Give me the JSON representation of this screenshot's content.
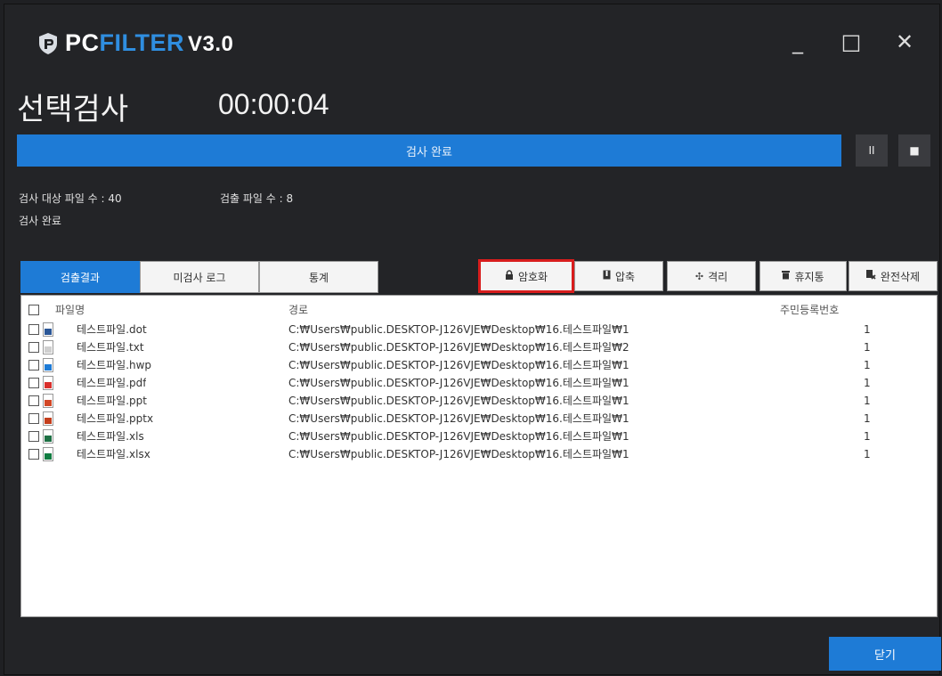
{
  "app": {
    "brand_pc": "PC",
    "brand_filter": "FILTER",
    "version": "V3.0",
    "accent": "#1e7bd6",
    "window_controls": [
      {
        "name": "minimize-icon",
        "glyph": "_"
      },
      {
        "name": "maximize-icon",
        "glyph": "□"
      },
      {
        "name": "close-icon",
        "glyph": "✕"
      }
    ]
  },
  "scan": {
    "title": "선택검사",
    "elapsed": "00:00:04",
    "progress_label": "검사 완료",
    "progress_fraction": 1.0,
    "pause_glyph": "II",
    "stop_glyph": "■",
    "target_count_label": "검사 대상 파일 수 : 40",
    "detected_count_label": "검출 파일 수 : 8",
    "status": "검사 완료"
  },
  "tabs": [
    {
      "label": "검출결과",
      "active": true
    },
    {
      "label": "미검사 로그",
      "active": false
    },
    {
      "label": "통계",
      "active": false
    }
  ],
  "actions": [
    {
      "label": "암호화",
      "icon": "lock-icon",
      "glyph": "🔒︎",
      "highlight": true
    },
    {
      "label": "압축",
      "icon": "archive-icon",
      "glyph": "▮",
      "highlight": false
    },
    {
      "label": "격리",
      "icon": "move-icon",
      "glyph": "✣",
      "highlight": false
    },
    {
      "label": "휴지통",
      "icon": "trash-icon",
      "glyph": "▬",
      "highlight": false
    },
    {
      "label": "완전삭제",
      "icon": "delete-icon",
      "glyph": "▞",
      "highlight": false
    }
  ],
  "table": {
    "columns": {
      "name": "파일명",
      "path": "경로",
      "rrn": "주민등록번호"
    },
    "rows": [
      {
        "name": "테스트파일.dot",
        "path": "C:₩Users₩public.DESKTOP-J126VJE₩Desktop₩16.테스트파일₩1",
        "rrn": "1",
        "icon": "word-file-icon",
        "color": "#2b5797"
      },
      {
        "name": "테스트파일.txt",
        "path": "C:₩Users₩public.DESKTOP-J126VJE₩Desktop₩16.테스트파일₩2",
        "rrn": "1",
        "icon": "text-file-icon",
        "color": "#cfcfcf"
      },
      {
        "name": "테스트파일.hwp",
        "path": "C:₩Users₩public.DESKTOP-J126VJE₩Desktop₩16.테스트파일₩1",
        "rrn": "1",
        "icon": "hwp-file-icon",
        "color": "#1e7bd6"
      },
      {
        "name": "테스트파일.pdf",
        "path": "C:₩Users₩public.DESKTOP-J126VJE₩Desktop₩16.테스트파일₩1",
        "rrn": "1",
        "icon": "pdf-file-icon",
        "color": "#d9302c"
      },
      {
        "name": "테스트파일.ppt",
        "path": "C:₩Users₩public.DESKTOP-J126VJE₩Desktop₩16.테스트파일₩1",
        "rrn": "1",
        "icon": "ppt-file-icon",
        "color": "#d24726"
      },
      {
        "name": "테스트파일.pptx",
        "path": "C:₩Users₩public.DESKTOP-J126VJE₩Desktop₩16.테스트파일₩1",
        "rrn": "1",
        "icon": "pptx-file-icon",
        "color": "#c43e1c"
      },
      {
        "name": "테스트파일.xls",
        "path": "C:₩Users₩public.DESKTOP-J126VJE₩Desktop₩16.테스트파일₩1",
        "rrn": "1",
        "icon": "xls-file-icon",
        "color": "#1d7044"
      },
      {
        "name": "테스트파일.xlsx",
        "path": "C:₩Users₩public.DESKTOP-J126VJE₩Desktop₩16.테스트파일₩1",
        "rrn": "1",
        "icon": "xlsx-file-icon",
        "color": "#107c41"
      }
    ]
  },
  "footer": {
    "close_label": "닫기"
  }
}
